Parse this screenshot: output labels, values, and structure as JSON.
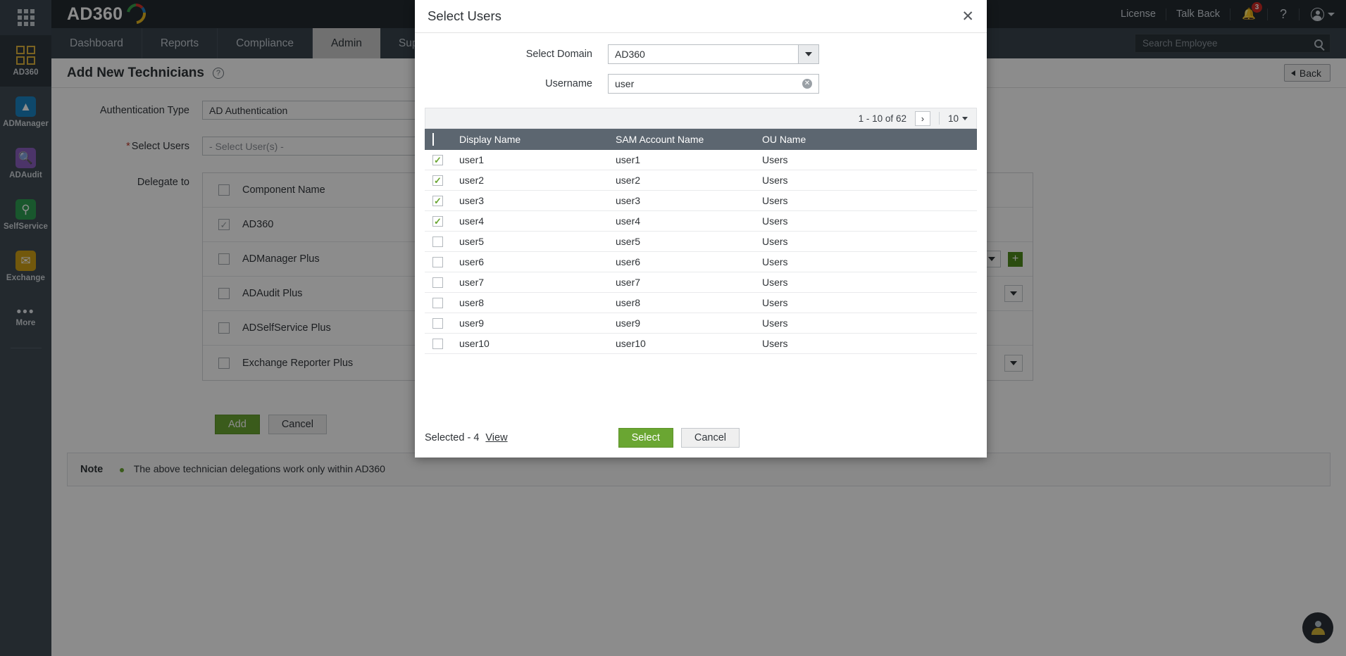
{
  "header": {
    "brand": "AD360",
    "links": [
      "License",
      "Talk Back"
    ],
    "notification_badge": "3",
    "help_glyph": "?",
    "bell_glyph": "🔔"
  },
  "nav": {
    "tabs": [
      {
        "label": "Dashboard",
        "active": false
      },
      {
        "label": "Reports",
        "active": false
      },
      {
        "label": "Compliance",
        "active": false
      },
      {
        "label": "Admin",
        "active": true
      },
      {
        "label": "Support",
        "active": false
      }
    ]
  },
  "search": {
    "placeholder": "Search Employee",
    "value": ""
  },
  "sidebar": {
    "items": [
      {
        "label": "AD360",
        "icon": "ad360-squares-icon",
        "active": true
      },
      {
        "label": "ADManager",
        "icon": "admanager-icon",
        "active": false
      },
      {
        "label": "ADAudit",
        "icon": "adaudit-icon",
        "active": false
      },
      {
        "label": "SelfService",
        "icon": "selfservice-key-icon",
        "active": false
      },
      {
        "label": "Exchange",
        "icon": "exchange-envelope-icon",
        "active": false
      },
      {
        "label": "More",
        "icon": "more-dots-icon",
        "active": false
      }
    ]
  },
  "page": {
    "title": "Add New Technicians",
    "back_label": "Back",
    "form": {
      "auth_type_label": "Authentication Type",
      "auth_type_value": "AD Authentication",
      "select_users_label": "Select Users",
      "select_users_placeholder": "- Select User(s) -",
      "delegate_label": "Delegate to",
      "component_header": "Component Name",
      "components": [
        {
          "name": "AD360",
          "checked": true,
          "disabled": true,
          "has_select": false,
          "has_plus": false
        },
        {
          "name": "ADManager Plus",
          "checked": false,
          "disabled": false,
          "has_select": true,
          "has_plus": true
        },
        {
          "name": "ADAudit Plus",
          "checked": false,
          "disabled": false,
          "has_select": true,
          "has_plus": false
        },
        {
          "name": "ADSelfService Plus",
          "checked": false,
          "disabled": false,
          "has_select": false,
          "has_plus": false
        },
        {
          "name": "Exchange Reporter Plus",
          "checked": false,
          "disabled": false,
          "has_select": true,
          "has_plus": false
        }
      ]
    },
    "actions": {
      "add_label": "Add",
      "cancel_label": "Cancel"
    },
    "note": {
      "label": "Note",
      "text": "The above technician delegations work only within AD360"
    }
  },
  "modal": {
    "title": "Select Users",
    "close_glyph": "✕",
    "domain_label": "Select Domain",
    "domain_value": "AD360",
    "username_label": "Username",
    "username_value": "user",
    "pager": {
      "range": "1 - 10 of 62",
      "next_glyph": "›",
      "page_size": "10"
    },
    "columns": [
      "Display Name",
      "SAM Account Name",
      "OU Name"
    ],
    "rows": [
      {
        "checked": true,
        "display_name": "user1",
        "sam": "user1",
        "ou": "Users"
      },
      {
        "checked": true,
        "display_name": "user2",
        "sam": "user2",
        "ou": "Users"
      },
      {
        "checked": true,
        "display_name": "user3",
        "sam": "user3",
        "ou": "Users"
      },
      {
        "checked": true,
        "display_name": "user4",
        "sam": "user4",
        "ou": "Users"
      },
      {
        "checked": false,
        "display_name": "user5",
        "sam": "user5",
        "ou": "Users"
      },
      {
        "checked": false,
        "display_name": "user6",
        "sam": "user6",
        "ou": "Users"
      },
      {
        "checked": false,
        "display_name": "user7",
        "sam": "user7",
        "ou": "Users"
      },
      {
        "checked": false,
        "display_name": "user8",
        "sam": "user8",
        "ou": "Users"
      },
      {
        "checked": false,
        "display_name": "user9",
        "sam": "user9",
        "ou": "Users"
      },
      {
        "checked": false,
        "display_name": "user10",
        "sam": "user10",
        "ou": "Users"
      }
    ],
    "footer": {
      "selected_text": "Selected - 4",
      "view_label": "View",
      "select_label": "Select",
      "cancel_label": "Cancel"
    }
  },
  "colors": {
    "accent_green": "#6aa632",
    "header_dark": "#232a30",
    "nav_dark": "#39444e",
    "rail": "#414c55",
    "table_header": "#5c6670",
    "badge_red": "#cf2b25"
  }
}
